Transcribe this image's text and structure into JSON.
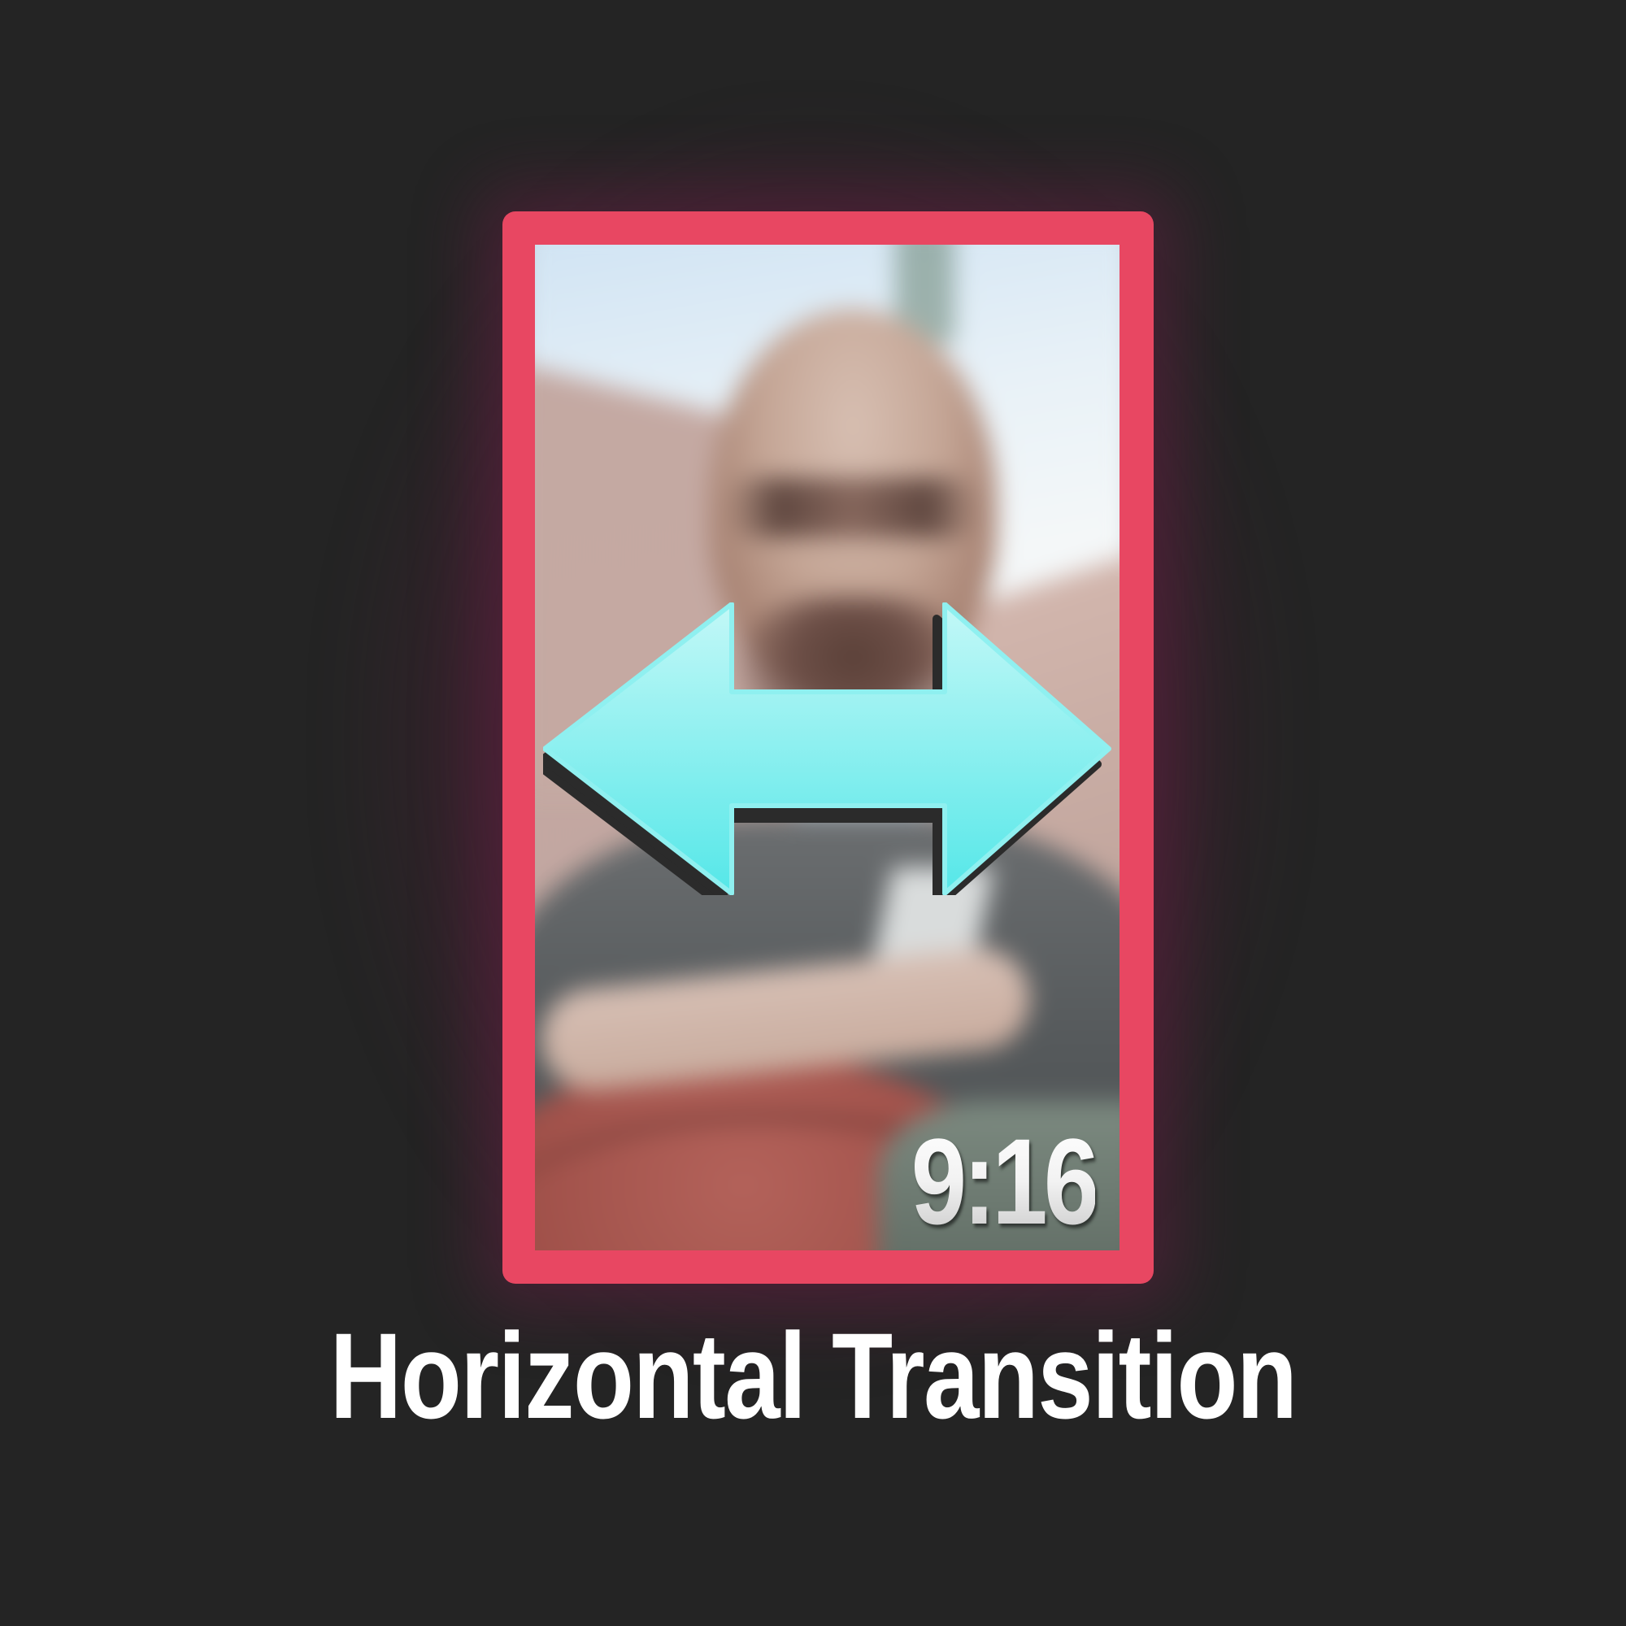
{
  "thumbnail": {
    "title": "Horizontal Transition",
    "aspect_ratio_label": "9:16",
    "colors": {
      "background": "#242424",
      "frame": "#e84762",
      "arrow_top": "#b6f6f6",
      "arrow_bottom": "#5fe9e9",
      "title_text": "#ffffff"
    },
    "icons": {
      "arrow": "double-headed-horizontal-arrow"
    }
  }
}
